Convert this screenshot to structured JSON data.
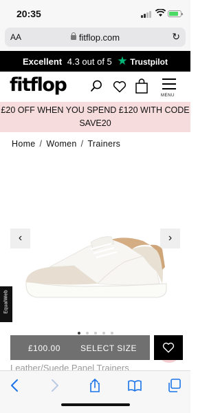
{
  "status_bar": {
    "time": "20:35"
  },
  "browser": {
    "text_size_label": "AA",
    "url": "fitflop.com"
  },
  "trustpilot": {
    "rating_word": "Excellent",
    "score_text": "4.3 out of 5",
    "brand": "Trustpilot"
  },
  "header": {
    "logo": "fitflop",
    "menu_label": "MENU"
  },
  "promo": {
    "line1": "£20 OFF WHEN YOU SPEND £120 WITH CODE",
    "line2": "SAVE20"
  },
  "breadcrumb": [
    {
      "label": "Home"
    },
    {
      "label": "Women"
    },
    {
      "label": "Trainers"
    }
  ],
  "gallery": {
    "dot_count": 5,
    "active_dot": 0
  },
  "accessibility": {
    "label": "EqualWeb"
  },
  "buy_bar": {
    "price": "£100.00",
    "select_label": "SELECT SIZE"
  },
  "product": {
    "title": "Leather/Suede Panel Trainers"
  },
  "colors": {
    "trust_star": "#00b67a",
    "promo_bg": "#f6dcdc",
    "buy_bar_bg": "#707070",
    "safari_blue": "#1a73e8"
  }
}
